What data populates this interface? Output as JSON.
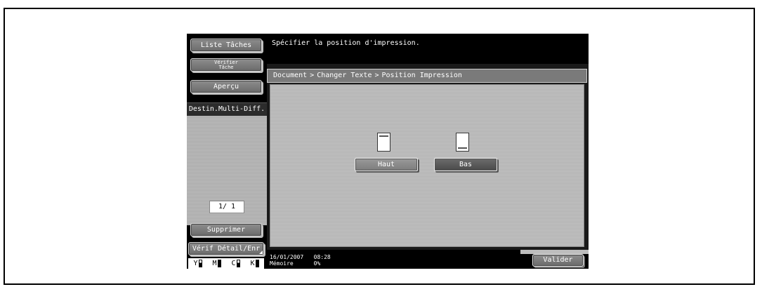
{
  "sidebar": {
    "liste_taches": "Liste Tâches",
    "verifier_tache_line1": "Vérifier",
    "verifier_tache_line2": "Tâche",
    "apercu": "Aperçu",
    "destin": "Destin.Multi-Diff.",
    "page_indicator": "1/ 1",
    "supprimer": "Supprimer",
    "verif_detail": "Vérif Détail/Enr",
    "toner": [
      {
        "label": "Y",
        "level": "half"
      },
      {
        "label": "M",
        "level": "full"
      },
      {
        "label": "C",
        "level": "half"
      },
      {
        "label": "K",
        "level": "full"
      }
    ]
  },
  "header": {
    "message": "Spécifier la position d'impression."
  },
  "breadcrumb": {
    "items": [
      "Document",
      "Changer Texte",
      "Position Impression"
    ],
    "separator": ">"
  },
  "options": {
    "haut": "Haut",
    "bas": "Bas",
    "selected": "Bas"
  },
  "footer": {
    "date": "16/01/2007",
    "time": "08:28",
    "memory_label": "Mémoire",
    "memory_value": "0%",
    "valider": "Valider"
  }
}
